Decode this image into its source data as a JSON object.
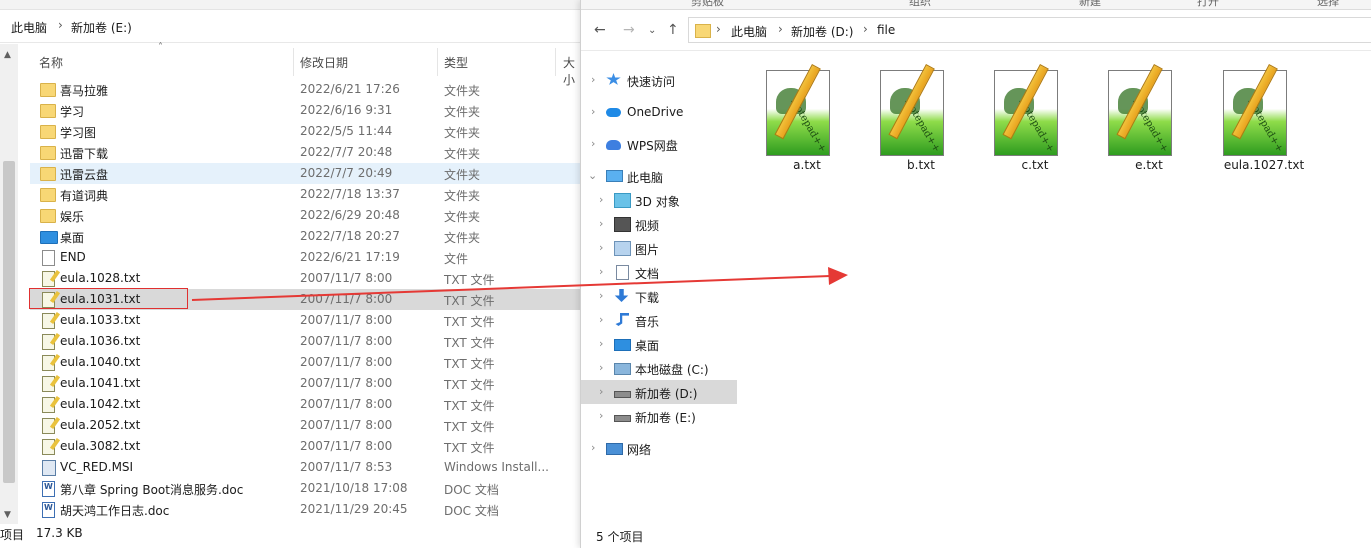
{
  "left": {
    "breadcrumb": [
      "此电脑",
      "新加卷 (E:)"
    ],
    "columns": {
      "name": "名称",
      "date": "修改日期",
      "type": "类型",
      "size": "大小"
    },
    "rows": [
      {
        "name": "喜马拉雅",
        "date": "2022/6/21 17:26",
        "type": "文件夹",
        "icon": "folder-icon"
      },
      {
        "name": "学习",
        "date": "2022/6/16 9:31",
        "type": "文件夹",
        "icon": "folder-icon"
      },
      {
        "name": "学习图",
        "date": "2022/5/5 11:44",
        "type": "文件夹",
        "icon": "folder-icon"
      },
      {
        "name": "迅雷下载",
        "date": "2022/7/7 20:48",
        "type": "文件夹",
        "icon": "folder-icon"
      },
      {
        "name": "迅雷云盘",
        "date": "2022/7/7 20:49",
        "type": "文件夹",
        "icon": "folder-icon"
      },
      {
        "name": "有道词典",
        "date": "2022/7/18 13:37",
        "type": "文件夹",
        "icon": "folder-icon"
      },
      {
        "name": "娱乐",
        "date": "2022/6/29 20:48",
        "type": "文件夹",
        "icon": "folder-icon"
      },
      {
        "name": "桌面",
        "date": "2022/7/18 20:27",
        "type": "文件夹",
        "icon": "desktop-icon"
      },
      {
        "name": "END",
        "date": "2022/6/21 17:19",
        "type": "文件",
        "icon": "file-icon"
      },
      {
        "name": "eula.1028.txt",
        "date": "2007/11/7 8:00",
        "type": "TXT 文件",
        "icon": "txt-file-icon"
      },
      {
        "name": "eula.1031.txt",
        "date": "2007/11/7 8:00",
        "type": "TXT 文件",
        "icon": "txt-file-icon"
      },
      {
        "name": "eula.1033.txt",
        "date": "2007/11/7 8:00",
        "type": "TXT 文件",
        "icon": "txt-file-icon"
      },
      {
        "name": "eula.1036.txt",
        "date": "2007/11/7 8:00",
        "type": "TXT 文件",
        "icon": "txt-file-icon"
      },
      {
        "name": "eula.1040.txt",
        "date": "2007/11/7 8:00",
        "type": "TXT 文件",
        "icon": "txt-file-icon"
      },
      {
        "name": "eula.1041.txt",
        "date": "2007/11/7 8:00",
        "type": "TXT 文件",
        "icon": "txt-file-icon"
      },
      {
        "name": "eula.1042.txt",
        "date": "2007/11/7 8:00",
        "type": "TXT 文件",
        "icon": "txt-file-icon"
      },
      {
        "name": "eula.2052.txt",
        "date": "2007/11/7 8:00",
        "type": "TXT 文件",
        "icon": "txt-file-icon"
      },
      {
        "name": "eula.3082.txt",
        "date": "2007/11/7 8:00",
        "type": "TXT 文件",
        "icon": "txt-file-icon"
      },
      {
        "name": "VC_RED.MSI",
        "date": "2007/11/7 8:53",
        "type": "Windows Install...",
        "icon": "msi-icon"
      },
      {
        "name": "第八章 Spring Boot消息服务.doc",
        "date": "2021/10/18 17:08",
        "type": "DOC 文档",
        "icon": "doc-icon"
      },
      {
        "name": "胡天鸿工作日志.doc",
        "date": "2021/11/29 20:45",
        "type": "DOC 文档",
        "icon": "doc-icon"
      }
    ],
    "status": {
      "count": "项目",
      "size": "17.3 KB"
    }
  },
  "right": {
    "ribbon": [
      "剪贴板",
      "组织",
      "新建",
      "打开",
      "选择"
    ],
    "breadcrumb": [
      "此电脑",
      "新加卷 (D:)",
      "file"
    ],
    "tree": [
      {
        "label": "快速访问",
        "icon": "star-icon",
        "level": 0
      },
      {
        "label": "OneDrive",
        "icon": "cloud-icon",
        "level": 0
      },
      {
        "label": "WPS网盘",
        "icon": "wps-cloud-icon",
        "level": 0
      },
      {
        "label": "此电脑",
        "icon": "computer-icon",
        "level": 0,
        "expanded": true
      },
      {
        "label": "3D 对象",
        "icon": "3d-objects-icon",
        "level": 1
      },
      {
        "label": "视频",
        "icon": "video-icon",
        "level": 1
      },
      {
        "label": "图片",
        "icon": "pictures-icon",
        "level": 1
      },
      {
        "label": "文档",
        "icon": "documents-icon",
        "level": 1
      },
      {
        "label": "下载",
        "icon": "download-icon",
        "level": 1
      },
      {
        "label": "音乐",
        "icon": "music-icon",
        "level": 1
      },
      {
        "label": "桌面",
        "icon": "desktop-icon",
        "level": 1
      },
      {
        "label": "本地磁盘 (C:)",
        "icon": "system-drive-icon",
        "level": 1
      },
      {
        "label": "新加卷 (D:)",
        "icon": "drive-icon",
        "level": 1,
        "selected": true
      },
      {
        "label": "新加卷 (E:)",
        "icon": "drive-icon",
        "level": 1
      },
      {
        "label": "网络",
        "icon": "network-icon",
        "level": 0
      }
    ],
    "files": [
      "a.txt",
      "b.txt",
      "c.txt",
      "e.txt",
      "eula.1027.txt"
    ],
    "notepad_label": "Notepad++",
    "status": "5 个项目"
  },
  "colors": {
    "accent": "#0078d7",
    "selection": "#d9d9d9",
    "highlight": "#e03030",
    "arrow": "#e53935"
  }
}
